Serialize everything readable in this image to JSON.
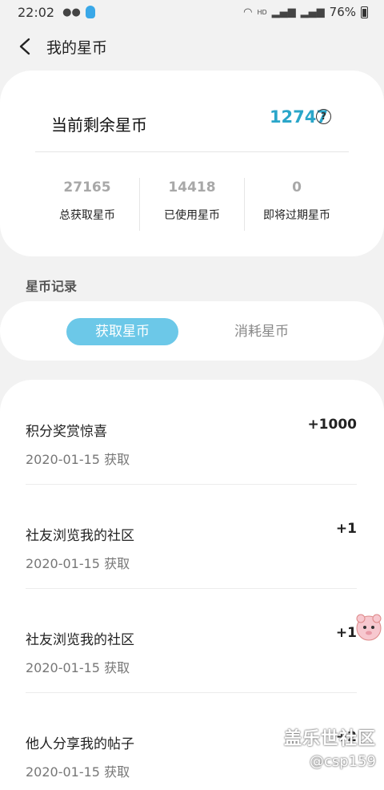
{
  "status_bar": {
    "time": "22:02",
    "battery": "76%",
    "icons": [
      "wechat-icon",
      "qq-icon",
      "wifi-icon",
      "hd-icon",
      "signal-4g-icon",
      "signal-4g-icon",
      "battery-icon"
    ]
  },
  "header": {
    "title": "我的星币",
    "back_icon": "chevron-left-icon"
  },
  "summary": {
    "label": "当前剩余星币",
    "value": "12747",
    "stats": [
      {
        "value": "27165",
        "label": "总获取星币"
      },
      {
        "value": "14418",
        "label": "已使用星币"
      },
      {
        "value": "0",
        "label": "即将过期星币"
      }
    ]
  },
  "section_title": "星币记录",
  "tabs": [
    {
      "label": "获取星币",
      "active": true
    },
    {
      "label": "消耗星币",
      "active": false
    }
  ],
  "records": [
    {
      "title": "积分奖赏惊喜",
      "date": "2020-01-15 获取",
      "amount": "+1000"
    },
    {
      "title": "社友浏览我的社区",
      "date": "2020-01-15 获取",
      "amount": "+1"
    },
    {
      "title": "社友浏览我的社区",
      "date": "2020-01-15 获取",
      "amount": "+1"
    },
    {
      "title": "他人分享我的帖子",
      "date": "2020-01-15 获取",
      "amount": "+2"
    }
  ],
  "watermark": {
    "title": "盖乐世社区",
    "handle": "@csp159"
  },
  "colors": {
    "accent": "#2aa6c9",
    "active_tab": "#6cc8e8",
    "background": "#f2f2f2"
  }
}
